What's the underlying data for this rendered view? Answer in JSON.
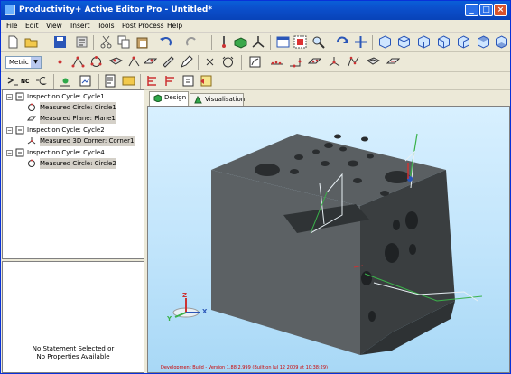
{
  "window": {
    "title": "Productivity+ Active Editor Pro - Untitled*"
  },
  "menu": [
    {
      "label": "File"
    },
    {
      "label": "Edit"
    },
    {
      "label": "View"
    },
    {
      "label": "Insert"
    },
    {
      "label": "Tools"
    },
    {
      "label": "Post Process"
    },
    {
      "label": "Help"
    }
  ],
  "units": {
    "selected": "Metric"
  },
  "toolbar3": {
    "nc_label": "NC"
  },
  "tree": {
    "nodes": [
      {
        "label": "Inspection Cycle: Cycle1",
        "icon": "cycle-icon",
        "level": 0,
        "selected": false,
        "expander": "−"
      },
      {
        "label": "Measured Circle: Circle1",
        "icon": "circle-feature-icon",
        "level": 1,
        "selected": true
      },
      {
        "label": "Measured Plane: Plane1",
        "icon": "plane-feature-icon",
        "level": 1,
        "selected": true
      },
      {
        "label": "Inspection Cycle: Cycle2",
        "icon": "cycle-icon",
        "level": 0,
        "selected": false,
        "expander": "−"
      },
      {
        "label": "Measured 3D Corner: Corner1",
        "icon": "corner-feature-icon",
        "level": 1,
        "selected": true
      },
      {
        "label": "Inspection Cycle: Cycle4",
        "icon": "cycle-icon",
        "level": 0,
        "selected": false,
        "expander": "−"
      },
      {
        "label": "Measured Circle: Circle2",
        "icon": "circle-feature-icon",
        "level": 1,
        "selected": true
      }
    ]
  },
  "properties": {
    "line1": "No Statement Selected or",
    "line2": "No Properties Available"
  },
  "tabs": [
    {
      "label": "Design",
      "active": true
    },
    {
      "label": "Visualisation",
      "active": false
    }
  ],
  "viewport": {
    "triad": {
      "x": "X",
      "y": "Y",
      "z": "Z"
    },
    "status": "Development Build - Version 1.88.2.999 (Built on Jul 12 2009 at 10:38:29)",
    "colors": {
      "part": "#4a4f52",
      "background": "#c6e7fb"
    }
  }
}
